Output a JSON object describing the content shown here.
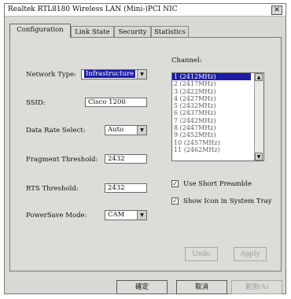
{
  "window": {
    "title": "Realtek RTL8180 Wireless LAN (Mini-)PCI NIC",
    "close": "✕"
  },
  "tabs": [
    "Configuration",
    "Link State",
    "Security",
    "Statistics"
  ],
  "config": {
    "network_type_label": "Network Type:",
    "network_type_value": "Infrastructure",
    "ssid_label": "SSID:",
    "ssid_value": "Cisco 1200",
    "data_rate_label": "Data Rate Select:",
    "data_rate_value": "Auto",
    "frag_label": "Fragment Threshold:",
    "frag_value": "2432",
    "rts_label": "RTS Threshold:",
    "rts_value": "2432",
    "power_label": "PowerSave Mode:",
    "power_value": "CAM",
    "channel_label": "Channel:",
    "channels": [
      "1 (2412MHz)",
      "2 (2417MHz)",
      "3 (2422MHz)",
      "4 (2427MHz)",
      "5 (2432MHz)",
      "6 (2437MHz)",
      "7 (2442MHz)",
      "8 (2447MHz)",
      "9 (2452MHz)",
      "10 (2457MHz)",
      "11 (2462MHz)"
    ],
    "selected_channel": "1 (2412MHz)",
    "short_preamble_label": "Use Short Preamble",
    "tray_icon_label": "Show Icon in System Tray",
    "undo_label": "Undo",
    "apply_label": "Apply"
  },
  "footer": {
    "ok_label": "確定",
    "cancel_label": "取消",
    "apply_label": "套用(A)"
  }
}
